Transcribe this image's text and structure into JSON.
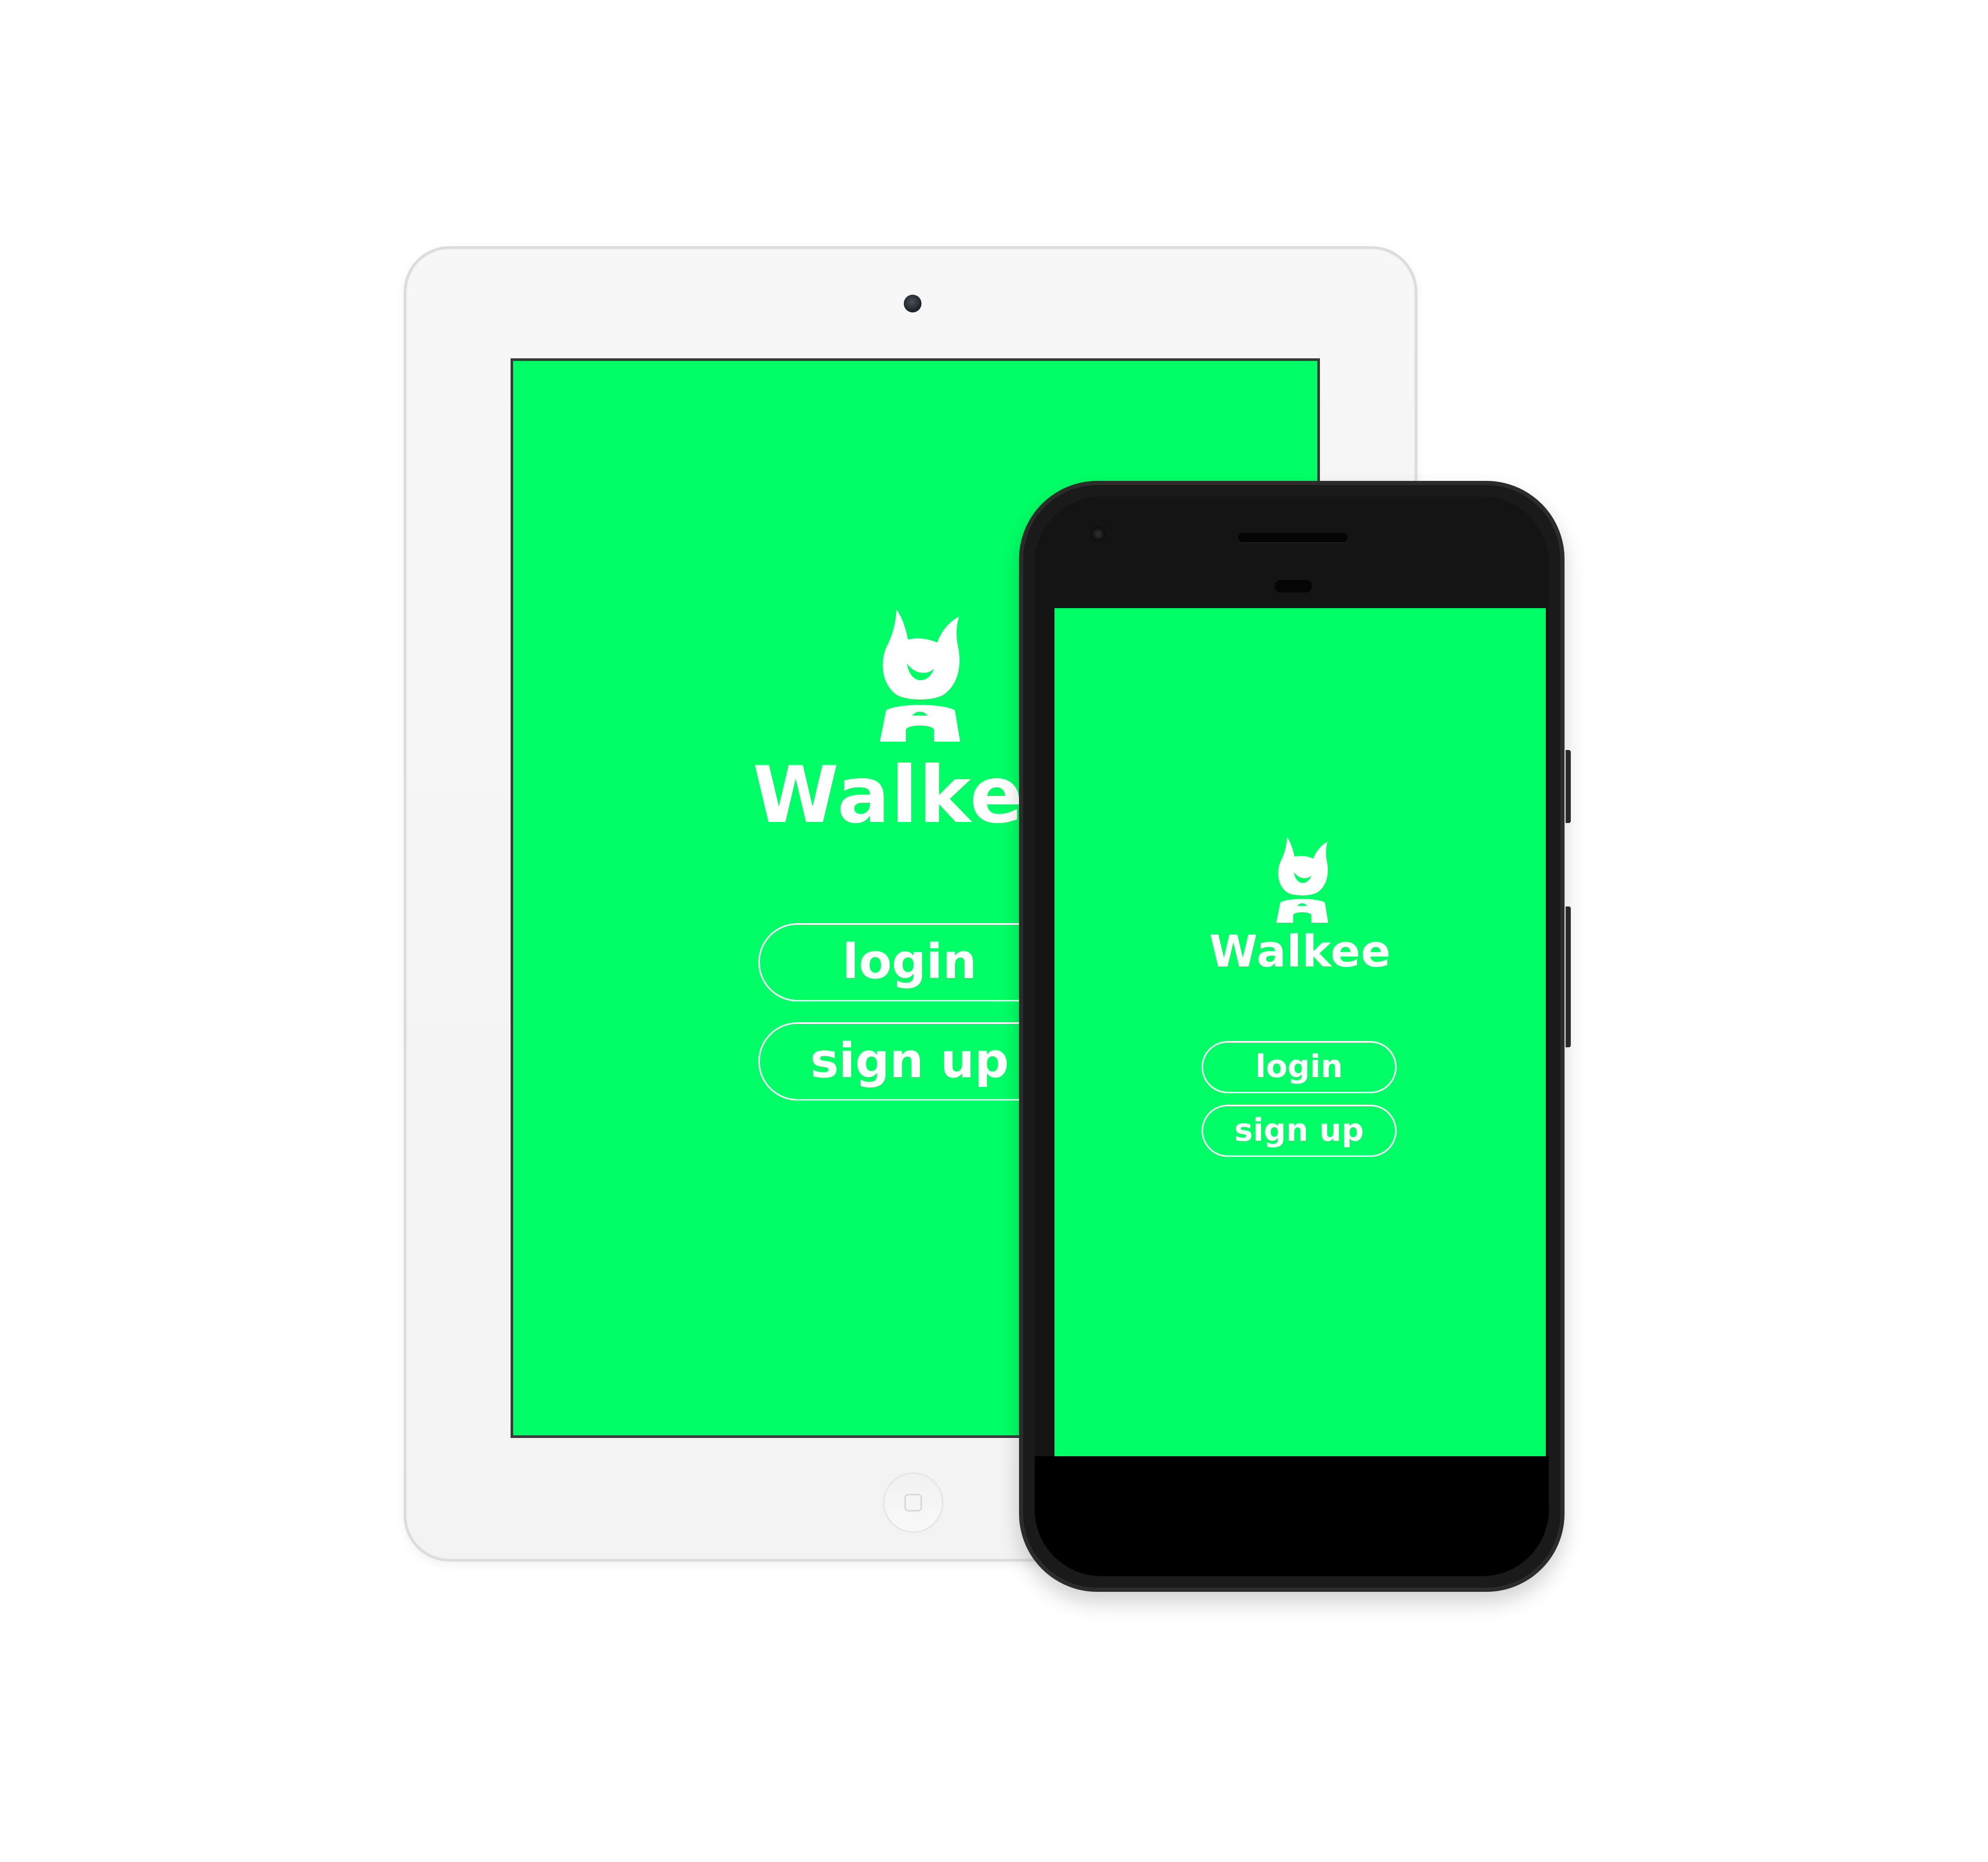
{
  "app": {
    "name": "Walkee",
    "logo_icon": "dog-head-icon",
    "accent_color": "#00ff66"
  },
  "tablet": {
    "title": "Walkee",
    "login_label": "login",
    "signup_label": "sign up"
  },
  "phone": {
    "title": "Walkee",
    "login_label": "login",
    "signup_label": "sign up"
  }
}
